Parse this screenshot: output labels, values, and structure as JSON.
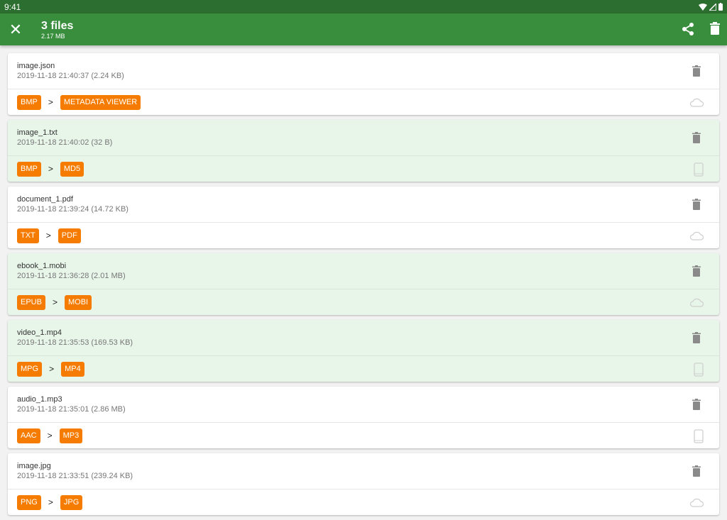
{
  "status_bar": {
    "time": "9:41"
  },
  "app_bar": {
    "title": "3 files",
    "subtitle": "2.17 MB"
  },
  "colors": {
    "primary": "#388e3c",
    "status": "#2c6e2f",
    "chip": "#f57c00",
    "selected": "#e8f5e9"
  },
  "files": [
    {
      "name": "image.json",
      "meta": "2019-11-18 21:40:37 (2.24 KB)",
      "from": "BMP",
      "to": "METADATA VIEWER",
      "storage": "cloud-icon",
      "selected": false
    },
    {
      "name": "image_1.txt",
      "meta": "2019-11-18 21:40:02 (32 B)",
      "from": "BMP",
      "to": "MD5",
      "storage": "phone-icon",
      "selected": true
    },
    {
      "name": "document_1.pdf",
      "meta": "2019-11-18 21:39:24 (14.72 KB)",
      "from": "TXT",
      "to": "PDF",
      "storage": "cloud-icon",
      "selected": false
    },
    {
      "name": "ebook_1.mobi",
      "meta": "2019-11-18 21:36:28 (2.01 MB)",
      "from": "EPUB",
      "to": "MOBI",
      "storage": "cloud-icon",
      "selected": true
    },
    {
      "name": "video_1.mp4",
      "meta": "2019-11-18 21:35:53 (169.53 KB)",
      "from": "MPG",
      "to": "MP4",
      "storage": "phone-icon",
      "selected": true
    },
    {
      "name": "audio_1.mp3",
      "meta": "2019-11-18 21:35:01 (2.86 MB)",
      "from": "AAC",
      "to": "MP3",
      "storage": "phone-icon",
      "selected": false
    },
    {
      "name": "image.jpg",
      "meta": "2019-11-18 21:33:51 (239.24 KB)",
      "from": "PNG",
      "to": "JPG",
      "storage": "cloud-icon",
      "selected": false
    }
  ]
}
